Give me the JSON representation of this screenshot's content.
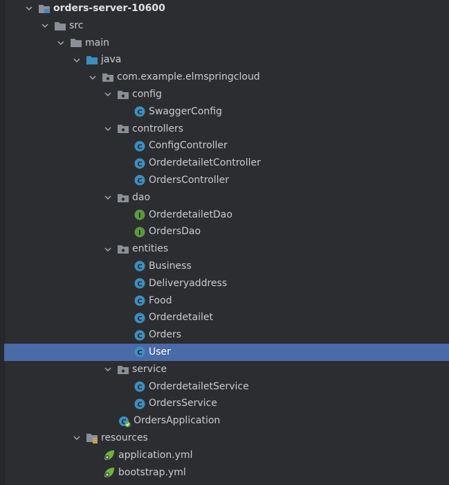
{
  "tree": {
    "root": "orders-server-10600",
    "src": "src",
    "main": "main",
    "java": "java",
    "package": "com.example.elmspringcloud",
    "config": "config",
    "swagger_config": "SwaggerConfig",
    "controllers": "controllers",
    "config_controller": "ConfigController",
    "orderdetailet_controller": "OrderdetailetController",
    "orders_controller": "OrdersController",
    "dao": "dao",
    "orderdetailet_dao": "OrderdetailetDao",
    "orders_dao": "OrdersDao",
    "entities": "entities",
    "business": "Business",
    "deliveryaddress": "Deliveryaddress",
    "food": "Food",
    "orderdetailet": "Orderdetailet",
    "orders": "Orders",
    "user": "User",
    "service": "service",
    "orderdetailet_service": "OrderdetailetService",
    "orders_service": "OrdersService",
    "orders_application": "OrdersApplication",
    "resources": "resources",
    "application_yml": "application.yml",
    "bootstrap_yml": "bootstrap.yml"
  },
  "icon_names": {
    "class": "class-icon",
    "interface": "interface-icon",
    "folder": "folder-icon",
    "package": "package-icon",
    "module": "module-icon",
    "spring": "spring-boot-icon",
    "resources": "resources-folder-icon"
  },
  "colors": {
    "background": "#2b2d30",
    "selection": "#4a6aa8",
    "class_icon": "#3d8fbf",
    "interface_icon": "#5a9a3c"
  }
}
